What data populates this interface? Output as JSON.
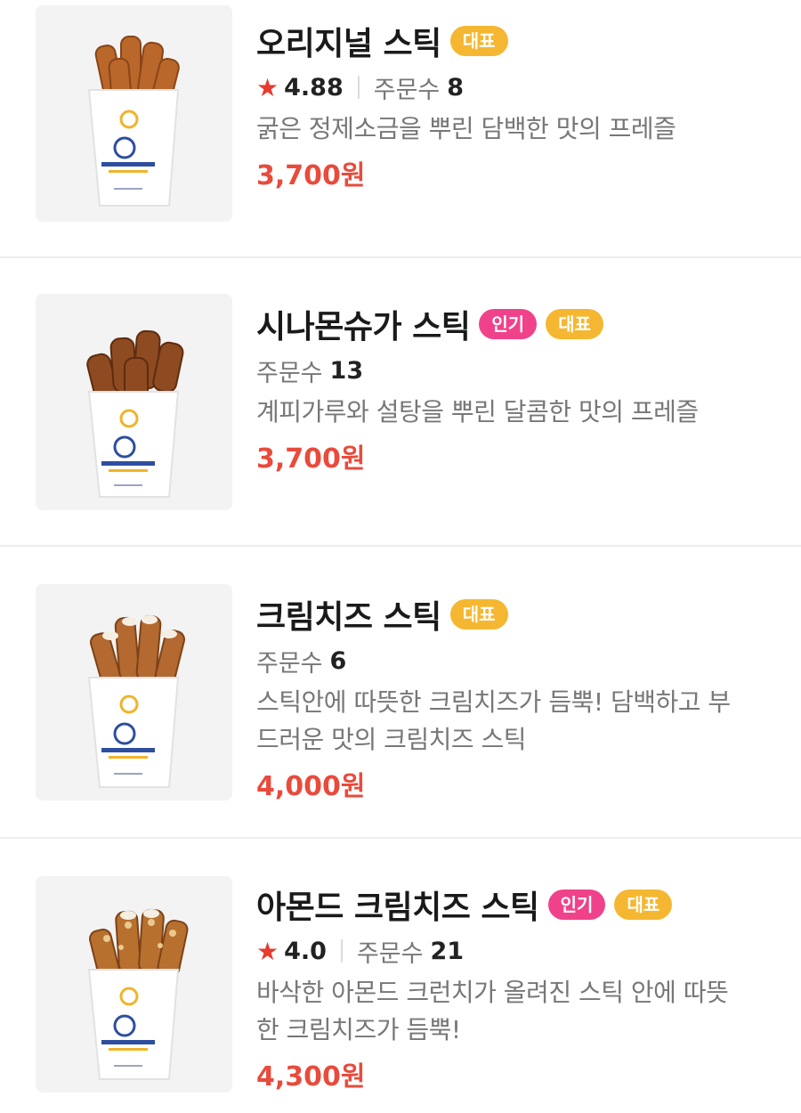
{
  "items": [
    {
      "name": "오리지널 스틱",
      "badges": {
        "pop": "",
        "rep": "대표"
      },
      "rating": "4.88",
      "orders_label": "주문수",
      "orders": "8",
      "description_lines": [
        "굵은 정제소금을 뿌린 담백한 맛의 프레즐"
      ],
      "price": "3,700원",
      "image_icon": "pretzel-stick-cup"
    },
    {
      "name": "시나몬슈가 스틱",
      "badges": {
        "pop": "인기",
        "rep": "대표"
      },
      "rating": "",
      "orders_label": "주문수",
      "orders": "13",
      "description_lines": [
        "계피가루와 설탕을 뿌린 달콤한 맛의 프레즐"
      ],
      "price": "3,700원",
      "image_icon": "pretzel-stick-cup"
    },
    {
      "name": "크림치즈 스틱",
      "badges": {
        "pop": "",
        "rep": "대표"
      },
      "rating": "",
      "orders_label": "주문수",
      "orders": "6",
      "description_lines": [
        "스틱안에 따뜻한 크림치즈가 듬뿍! 담백하고 부",
        "드러운 맛의 크림치즈 스틱"
      ],
      "price": "4,000원",
      "image_icon": "pretzel-stick-cup"
    },
    {
      "name": "아몬드 크림치즈 스틱",
      "badges": {
        "pop": "인기",
        "rep": "대표"
      },
      "rating": "4.0",
      "orders_label": "주문수",
      "orders": "21",
      "description_lines": [
        "바삭한 아몬드 크런치가 올려진 스틱 안에 따뜻",
        "한 크림치즈가 듬뿍!"
      ],
      "price": "4,300원",
      "image_icon": "pretzel-stick-cup"
    }
  ],
  "colors": {
    "price": "#e84b3c",
    "star": "#e63b2e",
    "badge_rep": "#f5b731",
    "badge_pop": "#f0428a",
    "divider": "#eeeeee"
  }
}
